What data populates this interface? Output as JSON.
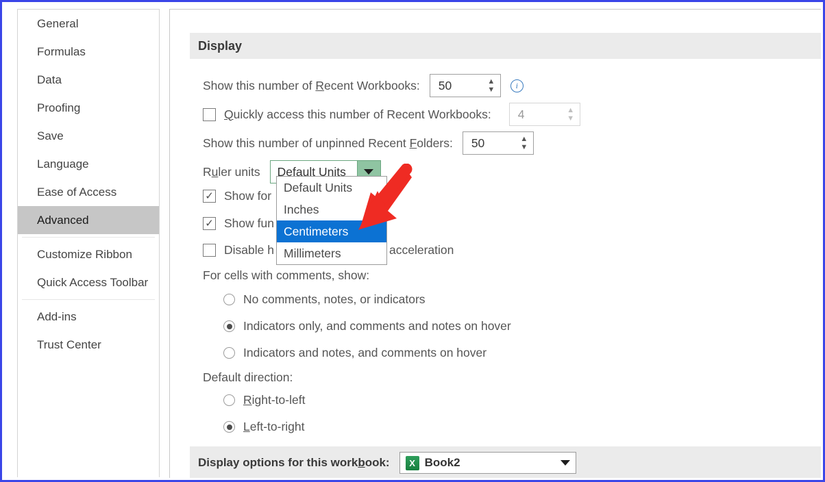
{
  "sidebar": {
    "items": [
      {
        "label": "General",
        "selected": false
      },
      {
        "label": "Formulas",
        "selected": false
      },
      {
        "label": "Data",
        "selected": false
      },
      {
        "label": "Proofing",
        "selected": false
      },
      {
        "label": "Save",
        "selected": false
      },
      {
        "label": "Language",
        "selected": false
      },
      {
        "label": "Ease of Access",
        "selected": false
      },
      {
        "label": "Advanced",
        "selected": true
      },
      {
        "label": "Customize Ribbon",
        "selected": false
      },
      {
        "label": "Quick Access Toolbar",
        "selected": false
      },
      {
        "label": "Add-ins",
        "selected": false
      },
      {
        "label": "Trust Center",
        "selected": false
      }
    ]
  },
  "display_section": {
    "heading": "Display",
    "recent_workbooks": {
      "label_before": "Show this number of ",
      "label_accel": "R",
      "label_after": "ecent Workbooks:",
      "value": "50",
      "info_glyph": "i"
    },
    "quick_access": {
      "label_accel": "Q",
      "label_after": "uickly access this number of Recent Workbooks:",
      "value": "4",
      "checked": false,
      "disabled": true
    },
    "recent_folders": {
      "label_before": "Show this number of unpinned Recent ",
      "label_accel": "F",
      "label_after": "olders:",
      "value": "50"
    },
    "ruler_units": {
      "label_before": "R",
      "label_accel": "u",
      "label_after": "ler units",
      "selected": "Default Units",
      "options": [
        "Default Units",
        "Inches",
        "Centimeters",
        "Millimeters"
      ],
      "highlighted": "Centimeters",
      "expanded": true
    },
    "checkboxes": [
      {
        "text_visible": "Show for",
        "checked": true
      },
      {
        "text_visible": "Show fun",
        "checked": true
      },
      {
        "text_visible": "Disable h",
        "text_tail": "acceleration",
        "checked": false
      }
    ],
    "comments_group": {
      "label": "For cells with comments, show:",
      "options": [
        {
          "label": "No comments, notes, or indicators",
          "selected": false
        },
        {
          "label": "Indicators only, and comments and notes on hover",
          "selected": true
        },
        {
          "label": "Indicators and notes, and comments on hover",
          "selected": false
        }
      ]
    },
    "direction_group": {
      "label": "Default direction:",
      "options": [
        {
          "label_accel": "R",
          "label_after": "ight-to-left",
          "selected": false
        },
        {
          "label_accel": "L",
          "label_after": "eft-to-right",
          "selected": true
        }
      ]
    }
  },
  "workbook_section": {
    "label_before": "Display options for this work",
    "label_accel": "b",
    "label_after": "ook:",
    "workbook_name": "Book2",
    "icon_letter": "X"
  },
  "colors": {
    "frame": "#3b46e8",
    "selected_nav": "#c6c6c6",
    "band": "#ebebeb",
    "highlight": "#0c72d3",
    "combo_green": "#8fc4a2",
    "arrow_red": "#ef2b23"
  }
}
